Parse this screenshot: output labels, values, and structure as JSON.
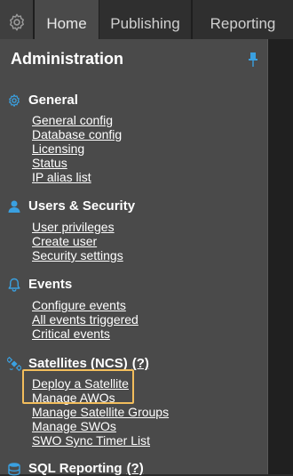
{
  "tabs": [
    {
      "label": "Home",
      "active": true
    },
    {
      "label": "Publishing",
      "active": false
    },
    {
      "label": "Reporting",
      "active": false
    }
  ],
  "panel": {
    "title": "Administration",
    "sections": [
      {
        "icon": "gear-icon",
        "title": "General",
        "help": "",
        "links": [
          "General config",
          "Database config",
          "Licensing",
          "Status",
          "IP alias list"
        ]
      },
      {
        "icon": "user-icon",
        "title": "Users & Security",
        "help": "",
        "links": [
          "User privileges",
          "Create user",
          "Security settings"
        ]
      },
      {
        "icon": "bell-icon",
        "title": "Events",
        "help": "",
        "links": [
          "Configure events",
          "All events triggered",
          "Critical events"
        ]
      },
      {
        "icon": "satellite-icon",
        "title": "Satellites (NCS)",
        "help": "(?)",
        "links": [
          "Deploy a Satellite",
          "Manage AWOs",
          "Manage Satellite Groups",
          "Manage SWOs",
          "SWO Sync Timer List"
        ]
      },
      {
        "icon": "database-icon",
        "title": "SQL Reporting",
        "help": "(?)",
        "links": []
      }
    ]
  },
  "colors": {
    "accent": "#3aa0e0",
    "highlight": "#f2bd5c"
  }
}
